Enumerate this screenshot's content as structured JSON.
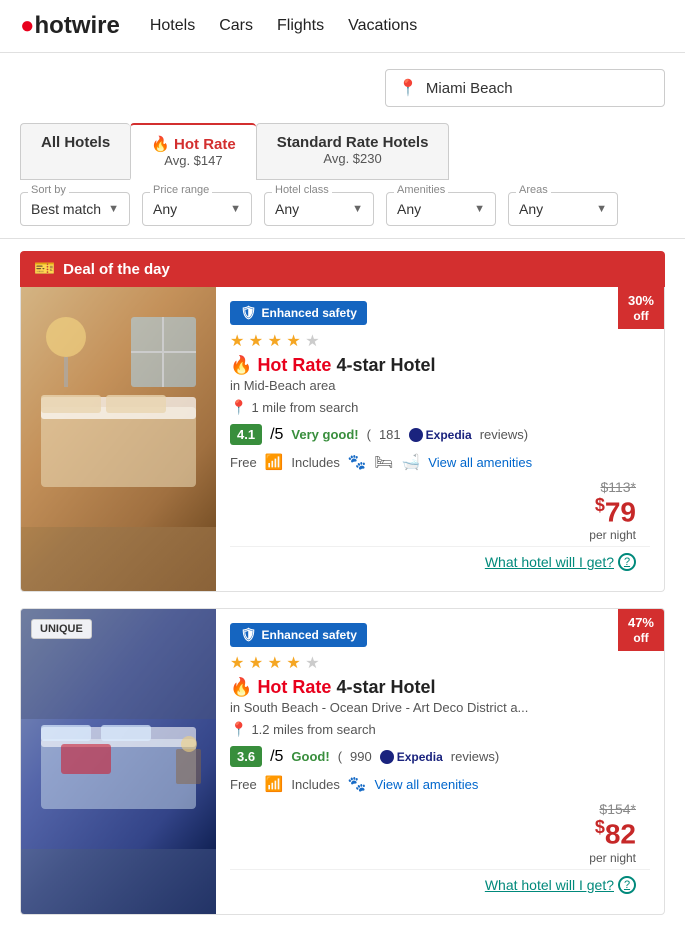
{
  "header": {
    "logo": "hotwire",
    "logo_dot": "●",
    "nav": [
      {
        "label": "Hotels",
        "id": "hotels"
      },
      {
        "label": "Cars",
        "id": "cars"
      },
      {
        "label": "Flights",
        "id": "flights"
      },
      {
        "label": "Vacations",
        "id": "vacations"
      }
    ]
  },
  "search": {
    "location": "Miami Beach",
    "placeholder": "Miami Beach"
  },
  "tabs": [
    {
      "id": "all",
      "title": "All Hotels",
      "subtitle": "",
      "active": false
    },
    {
      "id": "hot",
      "title": "Hot Rate",
      "subtitle": "Avg. $147",
      "active": true
    },
    {
      "id": "standard",
      "title": "Standard Rate Hotels",
      "subtitle": "Avg. $230",
      "active": false
    }
  ],
  "filters": {
    "sort_label": "Sort by",
    "sort_value": "Best match",
    "price_label": "Price range",
    "price_value": "Any",
    "class_label": "Hotel class",
    "class_value": "Any",
    "amenities_label": "Amenities",
    "amenities_value": "Any",
    "areas_label": "Areas",
    "areas_value": "Any"
  },
  "deal_banner": {
    "text": "Deal of the day"
  },
  "hotels": [
    {
      "id": "hotel1",
      "badge": "",
      "unique": false,
      "safety_label": "Enhanced safety",
      "stars": 4,
      "max_stars": 5,
      "type": "4-star Hotel",
      "hot_rate": true,
      "location": "in Mid-Beach area",
      "distance": "1 mile from search",
      "rating": "4.1/5",
      "rating_score": "4.1",
      "rating_label": "Very good!",
      "review_count": "181",
      "review_source": "Expedia",
      "amenities_free": "Free",
      "includes_label": "Includes",
      "view_all": "View all amenities",
      "original_price": "$113*",
      "sale_price": "79",
      "per_night": "per night",
      "discount": "30%",
      "discount_off": "off",
      "what_hotel": "What hotel will I get?"
    },
    {
      "id": "hotel2",
      "badge": "UNIQUE",
      "unique": true,
      "safety_label": "Enhanced safety",
      "stars": 4,
      "max_stars": 5,
      "type": "4-star Hotel",
      "hot_rate": true,
      "location": "in South Beach - Ocean Drive - Art Deco District a...",
      "distance": "1.2 miles from search",
      "rating": "3.6/5",
      "rating_score": "3.6",
      "rating_label": "Good!",
      "review_count": "990",
      "review_source": "Expedia",
      "amenities_free": "Free",
      "includes_label": "Includes",
      "view_all": "View all amenities",
      "original_price": "$154*",
      "sale_price": "82",
      "per_night": "per night",
      "discount": "47%",
      "discount_off": "off",
      "what_hotel": "What hotel will I get?"
    }
  ]
}
